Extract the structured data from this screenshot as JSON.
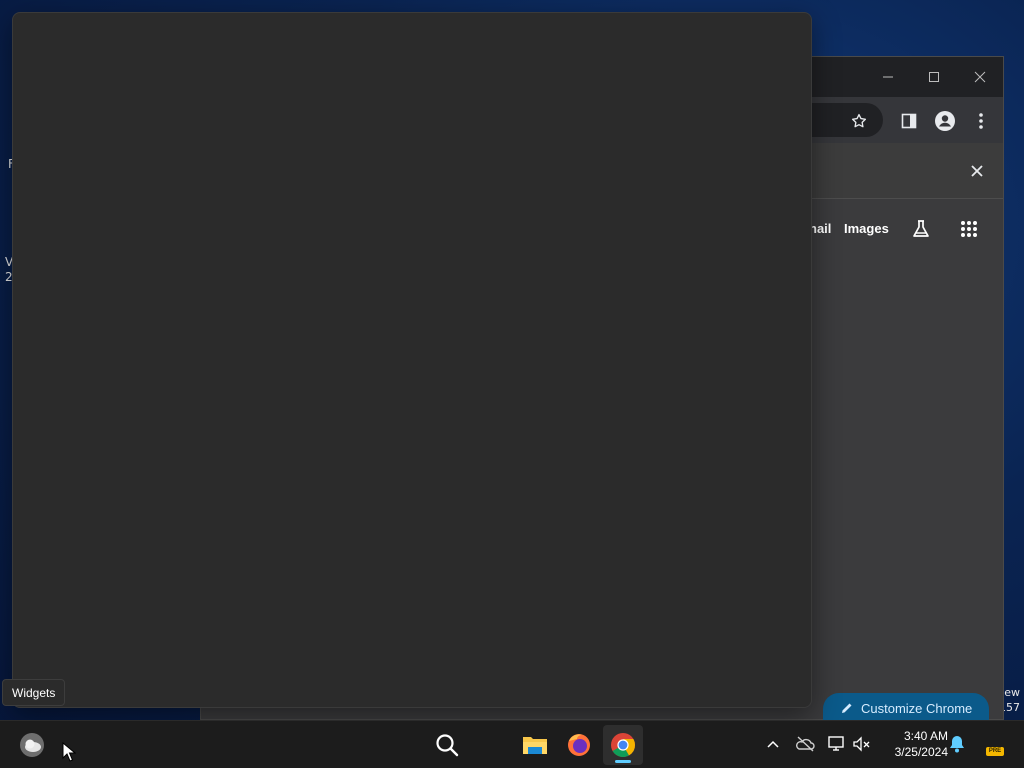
{
  "desktop": {
    "left_fragments": [
      "F",
      "V",
      "2("
    ],
    "right_fragments": [
      "ew",
      "157"
    ]
  },
  "chrome": {
    "window_controls": {
      "minimize": "minimize-icon",
      "maximize": "maximize-icon",
      "close": "close-icon"
    },
    "toolbar_icons": [
      "star-icon",
      "side-panel-icon",
      "profile-icon",
      "more-vert-icon"
    ],
    "ntp_links": {
      "gmail": "nail",
      "images": "Images"
    },
    "customize_label": "Customize Chrome"
  },
  "widgets_tooltip": "Widgets",
  "taskbar": {
    "apps": [
      "widgets-weather-icon",
      "search-icon",
      "file-explorer-icon",
      "firefox-icon",
      "chrome-icon"
    ],
    "active_app": "chrome",
    "tray": [
      "chevron-up-icon",
      "onedrive-offline-icon",
      "network-icon",
      "volume-muted-icon",
      "notification-bell-icon"
    ],
    "time": "3:40 AM",
    "date": "3/25/2024",
    "badge": "PRE"
  },
  "colors": {
    "accent": "#60cdff",
    "customize_bg": "#0b5a8a",
    "panel_bg": "#2b2b2b"
  }
}
